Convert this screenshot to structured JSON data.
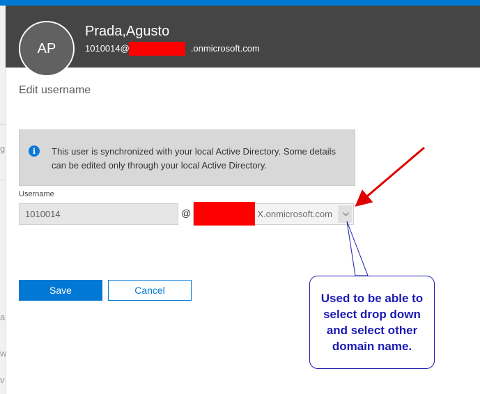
{
  "header": {
    "avatar_initials": "AP",
    "user_name": "Prada,Agusto",
    "user_email_prefix": "1010014@",
    "user_email_suffix": ".onmicrosoft.com"
  },
  "panel": {
    "title": "Edit username",
    "info_message": "This user is synchronized with your local Active Directory. Some details can be edited only through your local Active Directory."
  },
  "form": {
    "username_label": "Username",
    "username_value": "1010014",
    "at_sign": "@",
    "domain_value": "X.onmicrosoft.com"
  },
  "buttons": {
    "save_label": "Save",
    "cancel_label": "Cancel"
  },
  "annotation": {
    "callout_text": "Used to be able to select drop down and select other domain name."
  },
  "left_edge_chars": [
    "g",
    "a",
    "w",
    "v"
  ],
  "colors": {
    "accent": "#0078d4",
    "header_bg": "#454545",
    "redaction": "#ff0000",
    "callout_text": "#1a1ab4",
    "arrow": "#e00000"
  }
}
